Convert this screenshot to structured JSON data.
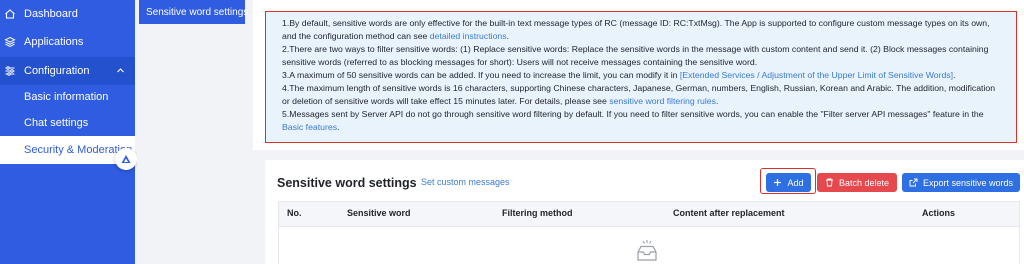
{
  "sidebar": {
    "dashboard": "Dashboard",
    "applications": "Applications",
    "configuration": "Configuration",
    "basic_information": "Basic information",
    "chat_settings": "Chat settings",
    "security_moderation": "Security & Moderation"
  },
  "subnav": {
    "sensitive_word_settings": "Sensitive word settings"
  },
  "notice": {
    "p1_text": "1.By default, sensitive words are only effective for the built-in text message types of RC (message ID: RC:TxtMsg). The App is supported to configure custom message types on its own, and the configuration method can see ",
    "p1_link": "detailed instructions",
    "p1_end": ".",
    "p2_text": "2.There are two ways to filter sensitive words: (1) Replace sensitive words: Replace the sensitive words in the message with custom content and send it. (2) Block messages containing sensitive words (referred to as blocking messages for short): Users will not receive messages containing the sensitive word.",
    "p3_text": "3.A maximum of 50 sensitive words can be added. If you need to increase the limit, you can modify it in ",
    "p3_link": "[Extended Services / Adjustment of the Upper Limit of Sensitive Words]",
    "p3_end": ".",
    "p4_text": "4.The maximum length of sensitive words is 16 characters, supporting Chinese characters, Japanese, German, numbers, English, Russian, Korean and Arabic. The addition, modification or deletion of sensitive words will take effect 15 minutes later. For details, please see ",
    "p4_link": "sensitive word filtering rules",
    "p4_end": ".",
    "p5_text": "5.Messages sent by Server API do not go through sensitive word filtering by default. If you need to filter sensitive words, you can enable the \"Filter server API messages\" feature in the ",
    "p5_link": "Basic features",
    "p5_end": "."
  },
  "main": {
    "title": "Sensitive word settings",
    "set_custom_messages": "Set custom messages",
    "add_label": "Add",
    "batch_delete_label": "Batch delete",
    "export_label": "Export sensitive words"
  },
  "table": {
    "columns": [
      "No.",
      "Sensitive word",
      "Filtering method",
      "Content after replacement",
      "Actions"
    ]
  },
  "colors": {
    "primary": "#2f5ce0",
    "danger": "#e5484d",
    "link": "#3a7bd5",
    "highlight_border": "#d9302c",
    "notice_bg": "#e9f3fb"
  },
  "icons": [
    "dashboard-icon",
    "applications-icon",
    "configuration-icon",
    "chevron-up-icon",
    "brand-icon",
    "plus-icon",
    "trash-icon",
    "export-icon",
    "empty-inbox-icon"
  ]
}
